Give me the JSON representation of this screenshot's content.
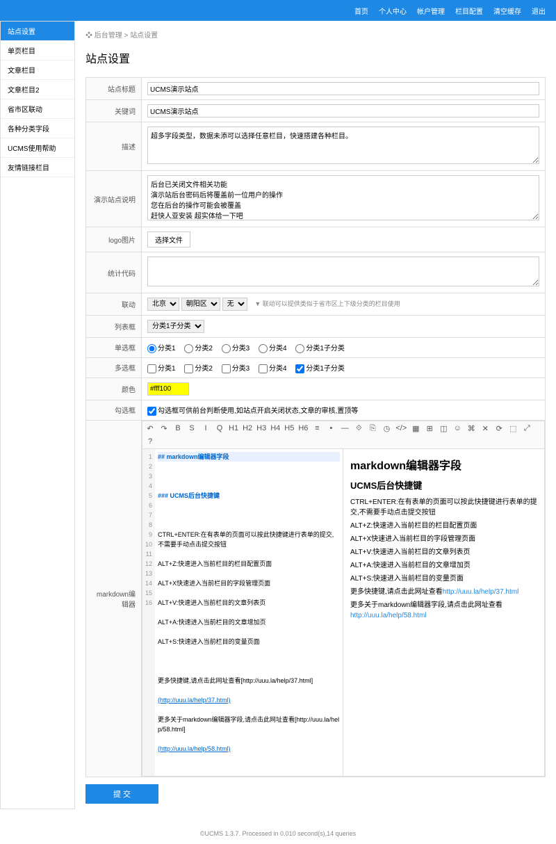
{
  "nav": {
    "home": "首页",
    "personal": "个人中心",
    "account": "帐户管理",
    "column": "栏目配置",
    "clear": "清空缓存",
    "logout": "退出"
  },
  "sidebar": [
    "站点设置",
    "单页栏目",
    "文章栏目",
    "文章栏目2",
    "省市区联动",
    "各种分类字段",
    "UCMS使用帮助",
    "友情链接栏目"
  ],
  "breadcrumb": {
    "icon": "❖",
    "a": "后台管理",
    "b": "站点设置"
  },
  "page_title": "站点设置",
  "labels": {
    "site_title": "站点标题",
    "keywords": "关键词",
    "desc": "描述",
    "demo_note": "演示站点说明",
    "logo": "logo图片",
    "stats": "统计代码",
    "linkage": "联动",
    "list": "列表框",
    "radio": "单选框",
    "checkbox": "多选框",
    "color": "颜色",
    "checknote": "勾选框",
    "markdown": "markdown编辑器"
  },
  "values": {
    "site_title": "UCMS演示站点",
    "keywords": "UCMS演示站点",
    "desc": "超多字段类型，数据未添可以选择任意栏目，快速搭建各种栏目。",
    "demo_note": "后台已关闭文件相关功能\n演示站后台密码后将覆盖前一位用户的操作\n您在后台的操作可能会被覆盖\n赶快人亚安装 超实体给一下吧",
    "stats": "",
    "color": "#fff100"
  },
  "file_btn": "选择文件",
  "linkage": {
    "opts": [
      "北京",
      "朝阳区",
      "无"
    ],
    "hint": "▼ 联动可以提供类似于省市区上下级分类的栏目使用"
  },
  "list": {
    "opt": "分类1子分类"
  },
  "radio": {
    "opts": [
      "分类1",
      "分类2",
      "分类3",
      "分类4",
      "分类1子分类"
    ]
  },
  "checkbox": {
    "opts": [
      "分类1",
      "分类2",
      "分类3",
      "分类4",
      "分类1子分类"
    ]
  },
  "checknote": "勾选框可供前台判断使用,如站点开启关闭状态,文章的审核,置顶等",
  "toolbar_icons": [
    "↶",
    "↷",
    "B",
    "S",
    "I",
    "Q",
    "H1",
    "H2",
    "H3",
    "H4",
    "H5",
    "H6",
    "≡",
    "•",
    "—",
    "⟐",
    "⎘",
    "◷",
    "</>",
    "▦",
    "⊞",
    "◫",
    "☺",
    "⌘",
    "✕",
    "⟳",
    "⬚",
    "⤢",
    "?"
  ],
  "md_source": {
    "l1": "## markdown编辑器字段",
    "l3": "### UCMS后台快捷键",
    "l5": "CTRL+ENTER:在有表单的页面可以按此快捷键进行表单的提交,不需要手动点击提交按钮",
    "l6": "ALT+Z:快速进入当前栏目的栏目配置页面",
    "l7": "ALT+X快速进入当前栏目的字段管理页面",
    "l8": "ALT+V:快速进入当前栏目的文章列表页",
    "l9": "ALT+A:快速进入当前栏目的文章增加页",
    "l10": "ALT+S:快速进入当前栏目的变量页面",
    "l12": "更多快捷键,请点击此网址查看[http://uuu.la/help/37.html]",
    "l12b": "(http://uuu.la/help/37.html)",
    "l14": "更多关于markdown编辑器字段,请点击此网址查看[http://uuu.la/help/58.html]",
    "l14b": "(http://uuu.la/help/58.html)"
  },
  "md_preview": {
    "h2": "markdown编辑器字段",
    "h3": "UCMS后台快捷键",
    "p1": "CTRL+ENTER:在有表单的页面可以按此快捷键进行表单的提交,不需要手动点击提交按钮",
    "p2": "ALT+Z:快速进入当前栏目的栏目配置页面",
    "p3": "ALT+X快速进入当前栏目的字段管理页面",
    "p4": "ALT+V:快速进入当前栏目的文章列表页",
    "p5": "ALT+A:快速进入当前栏目的文章增加页",
    "p6": "ALT+S:快速进入当前栏目的变量页面",
    "more1": "更多快捷键,请点击此网址查看",
    "link1": "http://uuu.la/help/37.html",
    "more2": "更多关于markdown编辑器字段,请点击此网址查看",
    "link2": "http://uuu.la/help/58.html"
  },
  "submit": "提 交",
  "footer": "©UCMS 1.3.7. Processed in 0.010 second(s),14 queries"
}
